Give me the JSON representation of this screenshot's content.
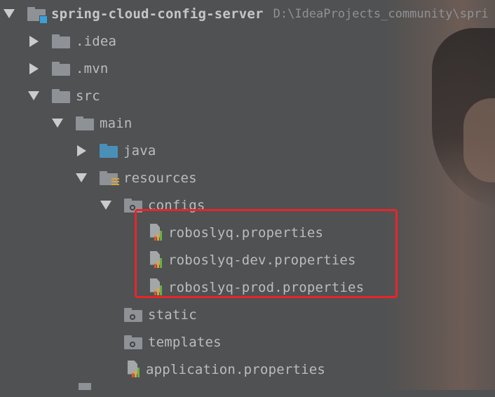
{
  "project": {
    "name": "spring-cloud-config-server",
    "path": "D:\\IdeaProjects_community\\spri"
  },
  "tree": {
    "idea": ".idea",
    "mvn": ".mvn",
    "src": "src",
    "main": "main",
    "java": "java",
    "resources": "resources",
    "configs": "configs",
    "files": [
      "roboslyq.properties",
      "roboslyq-dev.properties",
      "roboslyq-prod.properties"
    ],
    "static": "static",
    "templates": "templates",
    "application": "application.properties"
  },
  "colors": {
    "background": "#4f5152",
    "highlight_border": "#e8252a",
    "source_folder": "#4a8fb8"
  }
}
